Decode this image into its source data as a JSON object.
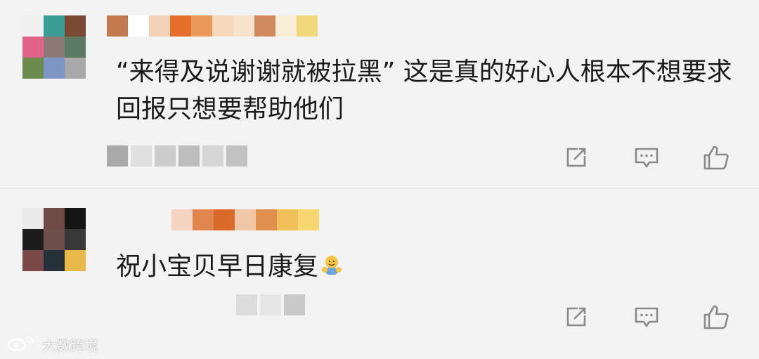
{
  "comments": [
    {
      "text": "“来得及说谢谢就被拉黑” 这是真的好心人根本不想要求回报只想要帮助他们",
      "avatar_colors": [
        "#f0f0f0",
        "#3a9e97",
        "#7a4a35",
        "#e0648a",
        "#8b7a76",
        "#5b7a64",
        "#6b8b4c",
        "#7e96c4",
        "#a8a8a8"
      ],
      "name_colors": [
        "#c47a50",
        "#ffffff",
        "#f4d2b9",
        "#e46e2a",
        "#e99a5a",
        "#f6d8bd",
        "#f7e2cb",
        "#d08a5d",
        "#fbeed8",
        "#f2d87c"
      ],
      "meta_colors": [
        "#aaaaaa",
        "#e0e0e0",
        "#cccccc",
        "#bdbdbd",
        "#d6d6d6",
        "#c2c2c2"
      ]
    },
    {
      "text": "祝小宝贝早日康复",
      "emoji": "hug-emoji",
      "avatar_colors": [
        "#e9e9e9",
        "#6e4b47",
        "#151515",
        "#1c1c1c",
        "#6f4f4b",
        "#383838",
        "#7a4a48",
        "#25303a",
        "#e8b84a"
      ],
      "name_colors": [
        "#f4d4c1",
        "#e0864e",
        "#d96a2a",
        "#f1c7a8",
        "#e0904e",
        "#f2c05a",
        "#f8d672"
      ],
      "meta_colors": [
        "#dcdcdc",
        "#e6e6e6",
        "#c9c9c9"
      ]
    }
  ],
  "actions": [
    "share-icon",
    "reply-icon",
    "like-icon"
  ],
  "colors": {
    "icon": "#8a8a8a",
    "text": "#1b1b1b",
    "background": "#f3f3f3",
    "divider": "#e6e6e6"
  },
  "watermark": {
    "text": "大数跨境",
    "icon": "weibo-logo-icon"
  }
}
